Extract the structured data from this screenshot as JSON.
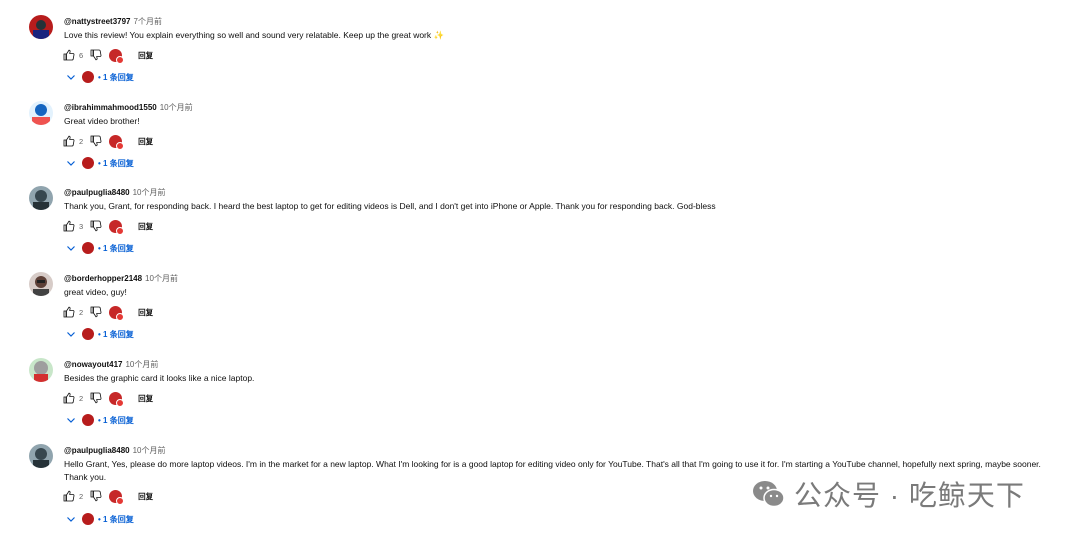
{
  "ui": {
    "reply_label": "回复"
  },
  "comments": [
    {
      "author": "@nattystreet3797",
      "time": "7个月前",
      "text": "Love this review! You explain everything so well and sound very relatable. Keep up the great work ✨",
      "likes": "6",
      "replies_label": "• 1 条回复",
      "avatar_color": "#b71c1c"
    },
    {
      "author": "@ibrahimmahmood1550",
      "time": "10个月前",
      "text": "Great video brother!",
      "likes": "2",
      "replies_label": "• 1 条回复",
      "avatar_color": "#1565c0"
    },
    {
      "author": "@paulpuglia8480",
      "time": "10个月前",
      "text": "Thank you, Grant, for responding back. I heard the best laptop to get for editing videos is Dell, and I don't get into iPhone or Apple. Thank you for responding back. God-bless",
      "likes": "3",
      "replies_label": "• 1 条回复",
      "avatar_color": "#37474f"
    },
    {
      "author": "@borderhopper2148",
      "time": "10个月前",
      "text": "great video, guy!",
      "likes": "2",
      "replies_label": "• 1 条回复",
      "avatar_color": "#5d4037"
    },
    {
      "author": "@nowayout417",
      "time": "10个月前",
      "text": "Besides the graphic card it looks like a nice laptop.",
      "likes": "2",
      "replies_label": "• 1 条回复",
      "avatar_color": "#9e9e9e"
    },
    {
      "author": "@paulpuglia8480",
      "time": "10个月前",
      "text": "Hello Grant, Yes, please do more laptop videos. I'm in the market for a new laptop. What I'm looking for is a good laptop for editing video only for YouTube. That's all that I'm going to use it for. I'm starting a YouTube channel, hopefully next spring, maybe sooner. Thank you.",
      "likes": "2",
      "replies_label": "• 1 条回复",
      "avatar_color": "#37474f"
    }
  ],
  "watermark": {
    "text": "公众号 · 吃鲸天下"
  }
}
